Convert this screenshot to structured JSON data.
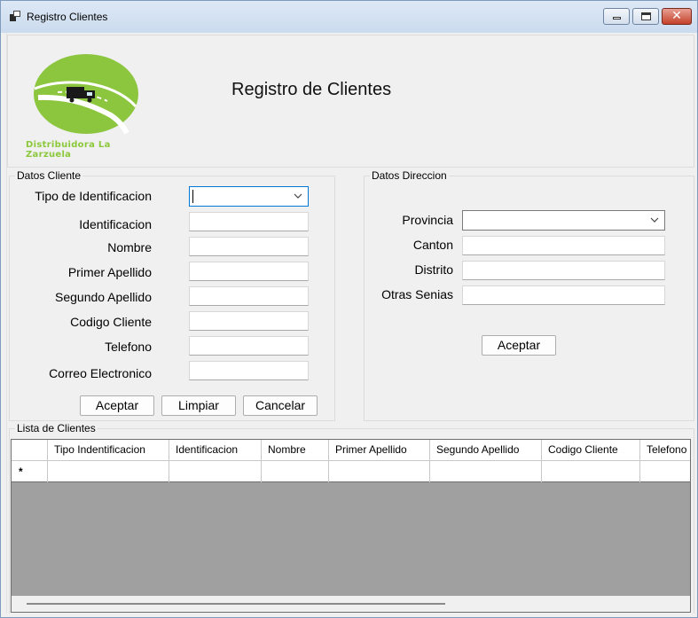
{
  "window": {
    "title": "Registro Clientes",
    "minimize_icon": "minimize-icon",
    "maximize_icon": "maximize-icon",
    "close_icon": "close-icon",
    "close_glyph": "✕"
  },
  "header": {
    "title": "Registro de Clientes",
    "logo_text": "Distribuidora La Zarzuela",
    "logo_colors": {
      "circle": "#8cc63f",
      "road": "#ffffff",
      "truck": "#1a1a1a"
    }
  },
  "datos_cliente": {
    "legend": "Datos Cliente",
    "fields": {
      "tipo_identificacion": {
        "label": "Tipo de Identificacion",
        "value": ""
      },
      "identificacion": {
        "label": "Identificacion",
        "value": ""
      },
      "nombre": {
        "label": "Nombre",
        "value": ""
      },
      "primer_apellido": {
        "label": "Primer Apellido",
        "value": ""
      },
      "segundo_apellido": {
        "label": "Segundo Apellido",
        "value": ""
      },
      "codigo_cliente": {
        "label": "Codigo Cliente",
        "value": ""
      },
      "telefono": {
        "label": "Telefono",
        "value": ""
      },
      "correo": {
        "label": "Correo Electronico",
        "value": ""
      }
    },
    "buttons": {
      "aceptar": "Aceptar",
      "limpiar": "Limpiar",
      "cancelar": "Cancelar"
    }
  },
  "datos_direccion": {
    "legend": "Datos Direccion",
    "fields": {
      "provincia": {
        "label": "Provincia",
        "value": ""
      },
      "canton": {
        "label": "Canton",
        "value": ""
      },
      "distrito": {
        "label": "Distrito",
        "value": ""
      },
      "otras_senias": {
        "label": "Otras Senias",
        "value": ""
      }
    },
    "buttons": {
      "aceptar": "Aceptar"
    }
  },
  "lista_clientes": {
    "legend": "Lista de Clientes",
    "columns": [
      "Tipo Indentificacion",
      "Identificacion",
      "Nombre",
      "Primer Apellido",
      "Segundo Apellido",
      "Codigo Cliente",
      "Telefono"
    ],
    "new_row_marker": "*"
  },
  "colors": {
    "focus_border": "#0078d7",
    "grid_background": "#a0a0a0"
  }
}
